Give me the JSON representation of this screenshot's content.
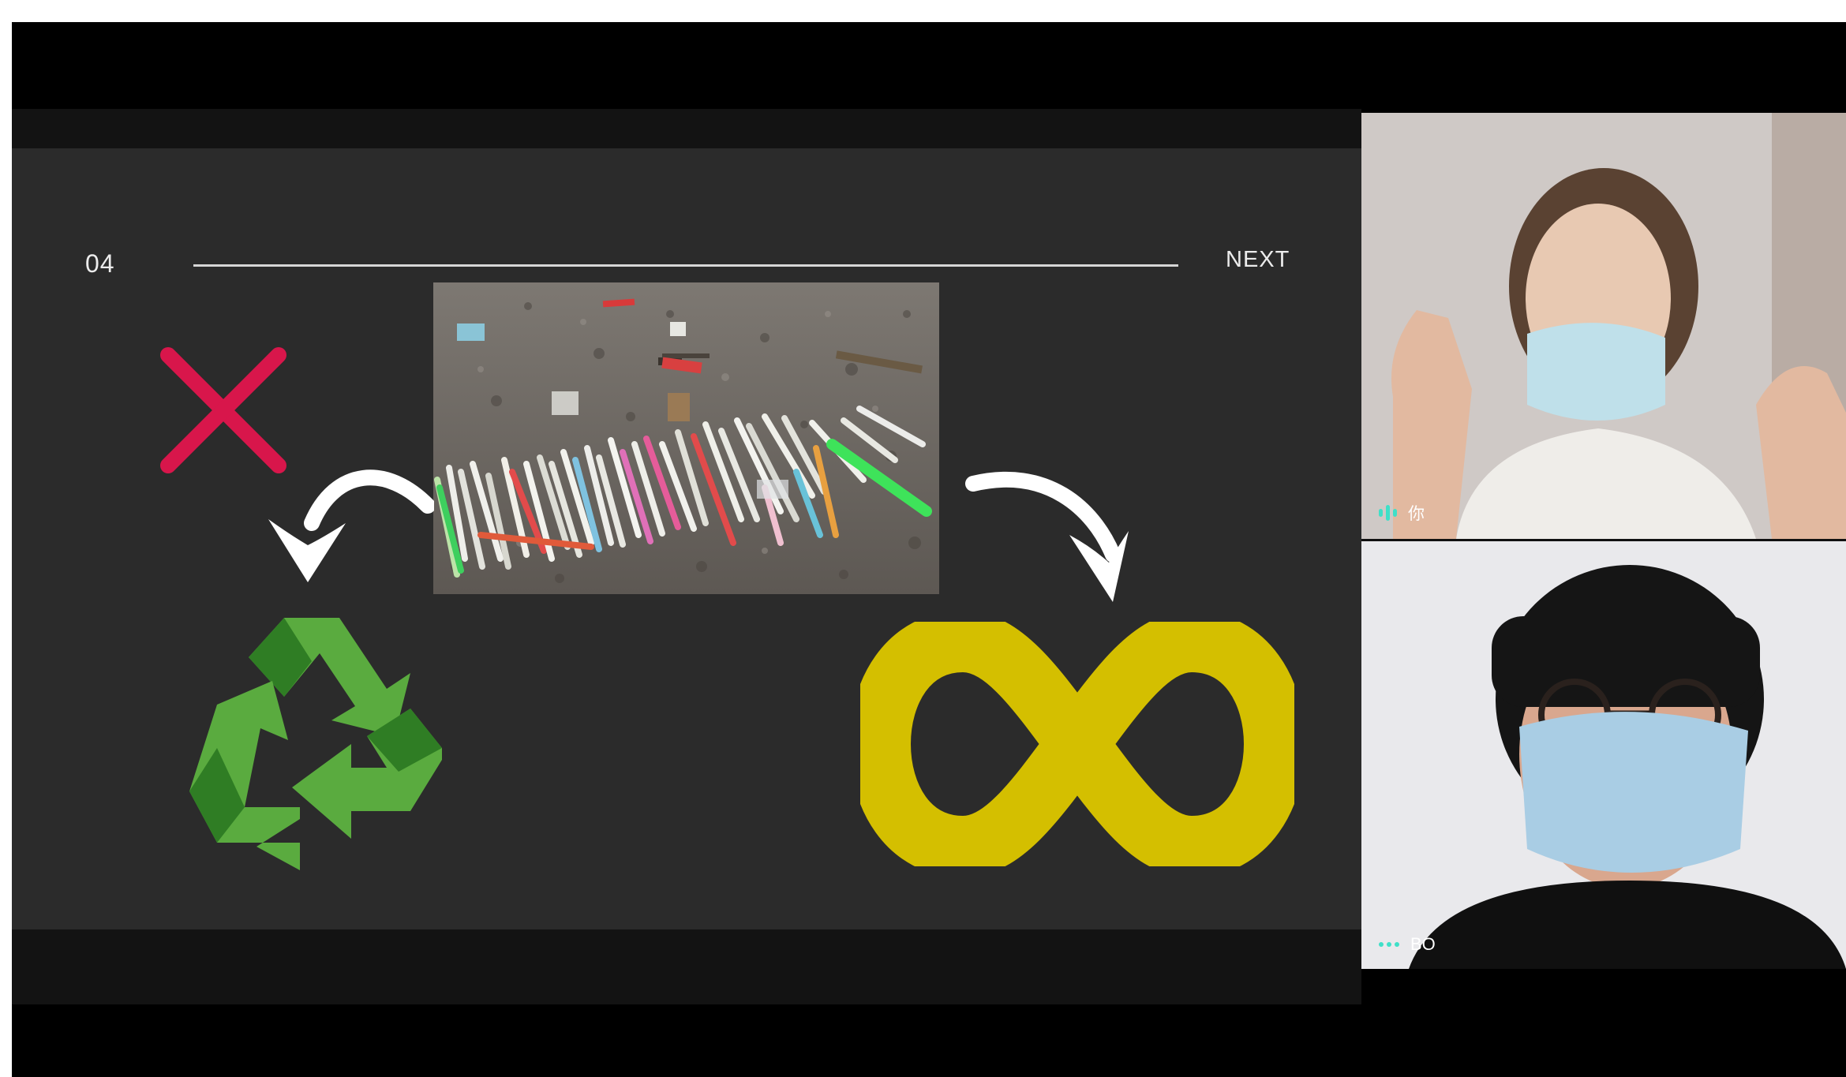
{
  "slide": {
    "number": "04",
    "next_label": "NEXT"
  },
  "participants": [
    {
      "name": "你",
      "status_icon": "speaking-indicator-icon",
      "speaking": true
    },
    {
      "name": "BO",
      "status_icon": "more-dots-icon",
      "speaking": false
    }
  ],
  "colors": {
    "slide_background": "#2b2b2b",
    "cross": "#d8164b",
    "recycle_green": "#5aab3f",
    "recycle_dark_green": "#2f7d24",
    "infinity_yellow": "#d4bf00",
    "indicator_teal": "#3fe0c8"
  },
  "icons": [
    "red-x-icon",
    "recycle-icon",
    "infinity-icon",
    "curved-arrow-left-icon",
    "curved-arrow-right-icon"
  ]
}
